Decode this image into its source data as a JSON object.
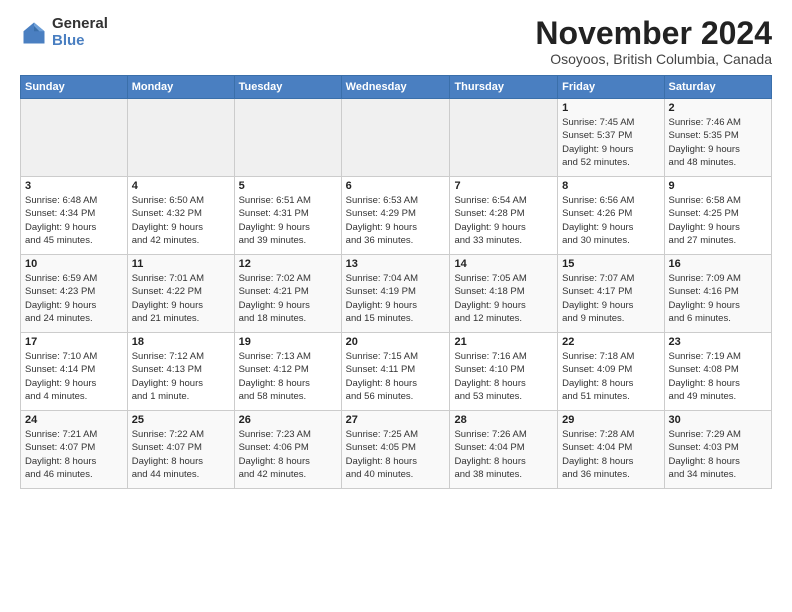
{
  "logo": {
    "general": "General",
    "blue": "Blue"
  },
  "title": "November 2024",
  "subtitle": "Osoyoos, British Columbia, Canada",
  "weekdays": [
    "Sunday",
    "Monday",
    "Tuesday",
    "Wednesday",
    "Thursday",
    "Friday",
    "Saturday"
  ],
  "weeks": [
    [
      {
        "day": "",
        "info": ""
      },
      {
        "day": "",
        "info": ""
      },
      {
        "day": "",
        "info": ""
      },
      {
        "day": "",
        "info": ""
      },
      {
        "day": "",
        "info": ""
      },
      {
        "day": "1",
        "info": "Sunrise: 7:45 AM\nSunset: 5:37 PM\nDaylight: 9 hours\nand 52 minutes."
      },
      {
        "day": "2",
        "info": "Sunrise: 7:46 AM\nSunset: 5:35 PM\nDaylight: 9 hours\nand 48 minutes."
      }
    ],
    [
      {
        "day": "3",
        "info": "Sunrise: 6:48 AM\nSunset: 4:34 PM\nDaylight: 9 hours\nand 45 minutes."
      },
      {
        "day": "4",
        "info": "Sunrise: 6:50 AM\nSunset: 4:32 PM\nDaylight: 9 hours\nand 42 minutes."
      },
      {
        "day": "5",
        "info": "Sunrise: 6:51 AM\nSunset: 4:31 PM\nDaylight: 9 hours\nand 39 minutes."
      },
      {
        "day": "6",
        "info": "Sunrise: 6:53 AM\nSunset: 4:29 PM\nDaylight: 9 hours\nand 36 minutes."
      },
      {
        "day": "7",
        "info": "Sunrise: 6:54 AM\nSunset: 4:28 PM\nDaylight: 9 hours\nand 33 minutes."
      },
      {
        "day": "8",
        "info": "Sunrise: 6:56 AM\nSunset: 4:26 PM\nDaylight: 9 hours\nand 30 minutes."
      },
      {
        "day": "9",
        "info": "Sunrise: 6:58 AM\nSunset: 4:25 PM\nDaylight: 9 hours\nand 27 minutes."
      }
    ],
    [
      {
        "day": "10",
        "info": "Sunrise: 6:59 AM\nSunset: 4:23 PM\nDaylight: 9 hours\nand 24 minutes."
      },
      {
        "day": "11",
        "info": "Sunrise: 7:01 AM\nSunset: 4:22 PM\nDaylight: 9 hours\nand 21 minutes."
      },
      {
        "day": "12",
        "info": "Sunrise: 7:02 AM\nSunset: 4:21 PM\nDaylight: 9 hours\nand 18 minutes."
      },
      {
        "day": "13",
        "info": "Sunrise: 7:04 AM\nSunset: 4:19 PM\nDaylight: 9 hours\nand 15 minutes."
      },
      {
        "day": "14",
        "info": "Sunrise: 7:05 AM\nSunset: 4:18 PM\nDaylight: 9 hours\nand 12 minutes."
      },
      {
        "day": "15",
        "info": "Sunrise: 7:07 AM\nSunset: 4:17 PM\nDaylight: 9 hours\nand 9 minutes."
      },
      {
        "day": "16",
        "info": "Sunrise: 7:09 AM\nSunset: 4:16 PM\nDaylight: 9 hours\nand 6 minutes."
      }
    ],
    [
      {
        "day": "17",
        "info": "Sunrise: 7:10 AM\nSunset: 4:14 PM\nDaylight: 9 hours\nand 4 minutes."
      },
      {
        "day": "18",
        "info": "Sunrise: 7:12 AM\nSunset: 4:13 PM\nDaylight: 9 hours\nand 1 minute."
      },
      {
        "day": "19",
        "info": "Sunrise: 7:13 AM\nSunset: 4:12 PM\nDaylight: 8 hours\nand 58 minutes."
      },
      {
        "day": "20",
        "info": "Sunrise: 7:15 AM\nSunset: 4:11 PM\nDaylight: 8 hours\nand 56 minutes."
      },
      {
        "day": "21",
        "info": "Sunrise: 7:16 AM\nSunset: 4:10 PM\nDaylight: 8 hours\nand 53 minutes."
      },
      {
        "day": "22",
        "info": "Sunrise: 7:18 AM\nSunset: 4:09 PM\nDaylight: 8 hours\nand 51 minutes."
      },
      {
        "day": "23",
        "info": "Sunrise: 7:19 AM\nSunset: 4:08 PM\nDaylight: 8 hours\nand 49 minutes."
      }
    ],
    [
      {
        "day": "24",
        "info": "Sunrise: 7:21 AM\nSunset: 4:07 PM\nDaylight: 8 hours\nand 46 minutes."
      },
      {
        "day": "25",
        "info": "Sunrise: 7:22 AM\nSunset: 4:07 PM\nDaylight: 8 hours\nand 44 minutes."
      },
      {
        "day": "26",
        "info": "Sunrise: 7:23 AM\nSunset: 4:06 PM\nDaylight: 8 hours\nand 42 minutes."
      },
      {
        "day": "27",
        "info": "Sunrise: 7:25 AM\nSunset: 4:05 PM\nDaylight: 8 hours\nand 40 minutes."
      },
      {
        "day": "28",
        "info": "Sunrise: 7:26 AM\nSunset: 4:04 PM\nDaylight: 8 hours\nand 38 minutes."
      },
      {
        "day": "29",
        "info": "Sunrise: 7:28 AM\nSunset: 4:04 PM\nDaylight: 8 hours\nand 36 minutes."
      },
      {
        "day": "30",
        "info": "Sunrise: 7:29 AM\nSunset: 4:03 PM\nDaylight: 8 hours\nand 34 minutes."
      }
    ]
  ]
}
